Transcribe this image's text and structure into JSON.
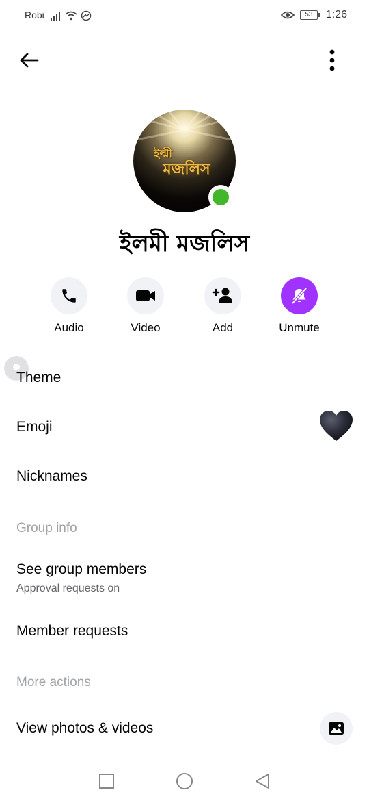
{
  "status_bar": {
    "carrier": "Robi",
    "battery": "53",
    "time": "1:26"
  },
  "header": {
    "back_icon": "arrow-left-icon",
    "menu_icon": "more-vertical-icon"
  },
  "profile": {
    "name": "ইলমী মজলিস",
    "avatar_logo_line1": "ইল্মী",
    "avatar_logo_line2": "মজলিস",
    "online": true,
    "online_color": "#42b72a"
  },
  "actions": [
    {
      "label": "Audio",
      "icon": "phone-icon"
    },
    {
      "label": "Video",
      "icon": "video-camera-icon"
    },
    {
      "label": "Add",
      "icon": "add-person-icon"
    },
    {
      "label": "Unmute",
      "icon": "bell-muted-icon",
      "accent": "#a033ff"
    }
  ],
  "customize": {
    "theme": "Theme",
    "emoji": "Emoji",
    "emoji_value": "black-heart",
    "nicknames": "Nicknames"
  },
  "group_info": {
    "heading": "Group info",
    "members": "See group members",
    "members_sub": "Approval requests on",
    "requests": "Member requests"
  },
  "more_actions": {
    "heading": "More actions",
    "photos": "View photos & videos"
  },
  "nav": {
    "recents": "square-icon",
    "home": "circle-icon",
    "back": "triangle-back-icon"
  }
}
